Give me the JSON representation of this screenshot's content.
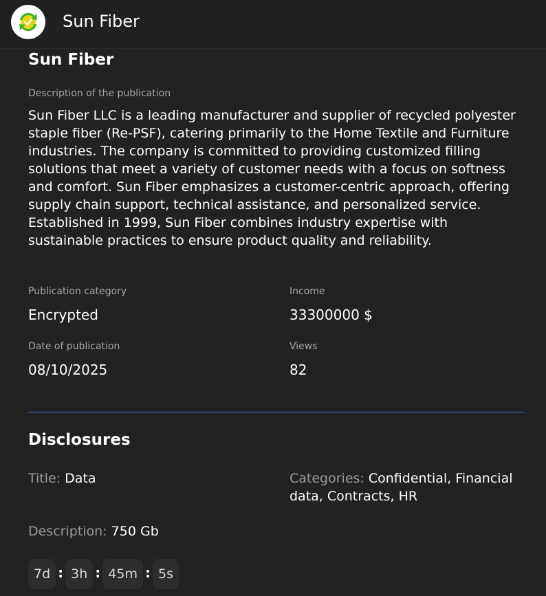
{
  "header": {
    "app_title": "Sun Fiber",
    "logo_icon": "recycle-arrows-icon",
    "accent_colors": {
      "green": "#43b02a",
      "yellow": "#e8d21d"
    }
  },
  "publication": {
    "title": "Sun Fiber",
    "description_label": "Description of the publication",
    "description": "Sun Fiber LLC is a leading manufacturer and supplier of recycled polyester staple fiber (Re-PSF), catering primarily to the Home Textile and Furniture industries. The company is committed to providing customized filling solutions that meet a variety of customer needs with a focus on softness and comfort. Sun Fiber emphasizes a customer-centric approach, offering supply chain support, technical assistance, and personalized service. Established in 1999, Sun Fiber combines industry expertise with sustainable practices to ensure product quality and reliability.",
    "category_label": "Publication category",
    "category": "Encrypted",
    "income_label": "Income",
    "income": "33300000 $",
    "date_label": "Date of publication",
    "date": "08/10/2025",
    "views_label": "Views",
    "views": "82"
  },
  "disclosures": {
    "section_title": "Disclosures",
    "title_key": "Title:",
    "title_value": "Data",
    "categories_key": "Categories:",
    "categories_value": "Confidential, Financial data, Contracts, HR",
    "description_key": "Description:",
    "description_value": "750 Gb",
    "divider_color": "#3f6fd8"
  },
  "countdown": {
    "days": "7d",
    "hours": "3h",
    "minutes": "45m",
    "seconds": "5s",
    "separator": ":"
  }
}
